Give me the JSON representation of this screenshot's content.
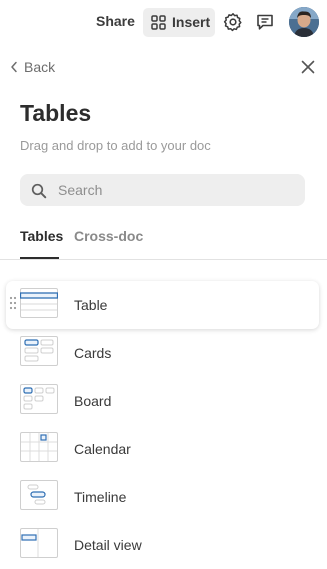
{
  "header": {
    "share_label": "Share",
    "insert_label": "Insert"
  },
  "panel": {
    "back_label": "Back",
    "title": "Tables",
    "subtitle": "Drag and drop to add to your doc",
    "search": {
      "placeholder": "Search",
      "value": ""
    },
    "tabs": [
      {
        "label": "Tables",
        "active": true
      },
      {
        "label": "Cross-doc",
        "active": false
      }
    ],
    "items": [
      {
        "label": "Table",
        "icon": "table-view-icon",
        "hovered": true
      },
      {
        "label": "Cards",
        "icon": "cards-view-icon"
      },
      {
        "label": "Board",
        "icon": "board-view-icon"
      },
      {
        "label": "Calendar",
        "icon": "calendar-view-icon"
      },
      {
        "label": "Timeline",
        "icon": "timeline-view-icon"
      },
      {
        "label": "Detail view",
        "icon": "detail-view-icon"
      }
    ]
  },
  "colors": {
    "accent": "#2f6fb3",
    "thumb_fill": "#eaf2fb",
    "thumb_border": "#cfcfcf"
  }
}
